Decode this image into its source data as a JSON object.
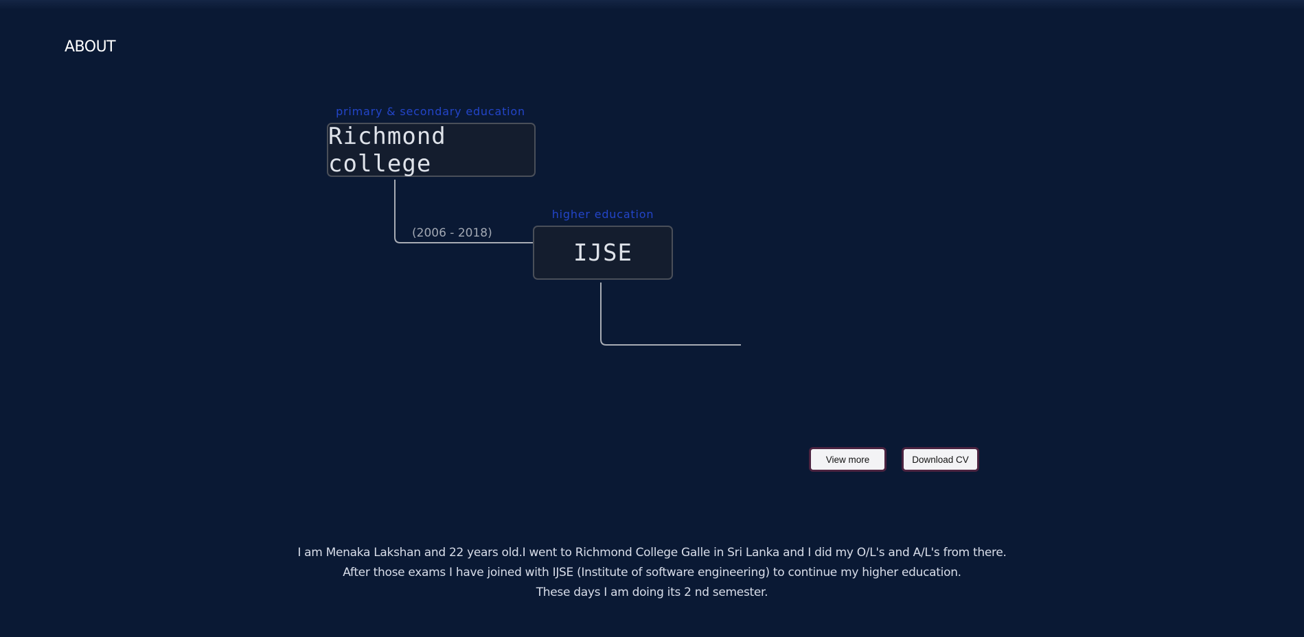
{
  "section": {
    "title": "ABOUT"
  },
  "timeline": {
    "nodes": [
      {
        "caption": "primary & secondary education",
        "label": "Richmond college"
      },
      {
        "caption": "higher education",
        "label": "IJSE"
      }
    ],
    "connector_label": "(2006 - 2018)"
  },
  "actions": {
    "view_more": "View more",
    "download_cv": "Download CV"
  },
  "bio": {
    "lines": [
      "I am Menaka Lakshan and 22 years old.I went to Richmond College Galle in Sri Lanka and I did my O/L's and A/L's from there.",
      "After those exams I have joined with IJSE (Institute of software engineering) to continue my higher education.",
      "These days I am doing its 2 nd semester."
    ]
  },
  "colors": {
    "background": "#0a1934",
    "caption_accent": "#2345c9",
    "button_border": "#4b2340"
  }
}
